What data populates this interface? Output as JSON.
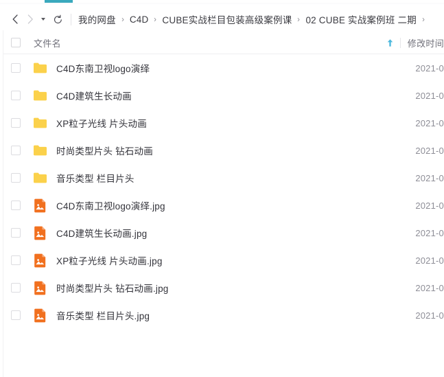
{
  "window": {
    "accent_color": "#3aa9bd",
    "background": "#ffffff"
  },
  "toolbar": {
    "back_label": "后退",
    "forward_label": "前进",
    "history_label": "历史",
    "refresh_label": "刷新"
  },
  "breadcrumb": {
    "separator": "›",
    "items": [
      {
        "label": "我的网盘"
      },
      {
        "label": "C4D"
      },
      {
        "label": "CUBE实战栏目包装高级案例课"
      },
      {
        "label": "02 CUBE 实战案例班 二期"
      }
    ],
    "trailing_separator": "›"
  },
  "table": {
    "columns": {
      "name": "文件名",
      "modified": "修改时间"
    },
    "sort": {
      "column": "modified",
      "direction": "asc",
      "indicator_color": "#4cb8dd"
    },
    "select_all_checked": false,
    "colors": {
      "folder_icon": "#fbd14b",
      "image_icon": "#f1701f"
    },
    "rows": [
      {
        "name": "C4D东南卫视logo演绎",
        "type": "folder",
        "modified": "2021-0"
      },
      {
        "name": "C4D建筑生长动画",
        "type": "folder",
        "modified": "2021-0"
      },
      {
        "name": "XP粒子光线 片头动画",
        "type": "folder",
        "modified": "2021-0"
      },
      {
        "name": "时尚类型片头 钻石动画",
        "type": "folder",
        "modified": "2021-0"
      },
      {
        "name": "音乐类型 栏目片头",
        "type": "folder",
        "modified": "2021-0"
      },
      {
        "name": "C4D东南卫视logo演绎.jpg",
        "type": "image",
        "modified": "2021-0"
      },
      {
        "name": "C4D建筑生长动画.jpg",
        "type": "image",
        "modified": "2021-0"
      },
      {
        "name": "XP粒子光线 片头动画.jpg",
        "type": "image",
        "modified": "2021-0"
      },
      {
        "name": "时尚类型片头 钻石动画.jpg",
        "type": "image",
        "modified": "2021-0"
      },
      {
        "name": "音乐类型 栏目片头.jpg",
        "type": "image",
        "modified": "2021-0"
      }
    ]
  }
}
